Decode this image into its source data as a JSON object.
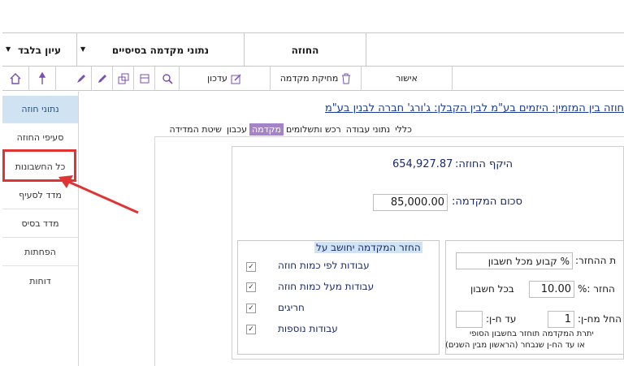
{
  "topbar": {
    "view_only": "עיון בלבד",
    "basic_advance_data": "נתוני מקדמה בסיסיים",
    "contract": "החוזה"
  },
  "toolbar": {
    "update": "עדכון",
    "delete_advance": "מחיקת מקדמה",
    "approve": "אישור"
  },
  "sidebar": {
    "items": [
      {
        "label": "נתוני חוזה"
      },
      {
        "label": "סעיפי החוזה"
      },
      {
        "label": "כל החשבונות"
      },
      {
        "label": "מדד לסעיף"
      },
      {
        "label": "מדד בסיס"
      },
      {
        "label": "הפחתות"
      },
      {
        "label": "דוחות"
      }
    ]
  },
  "main": {
    "title": "חוזה בין המזמין: היזמים בע\"מ  לבין הקבלן: ג'ורג' חברה לבנין בע\"מ",
    "tabs": [
      {
        "label": "כללי"
      },
      {
        "label": "נתוני עבודה"
      },
      {
        "label": "רכש ותשלומים"
      },
      {
        "label": "מקדמה"
      },
      {
        "label": "עכבון"
      },
      {
        "label": "שיטת המדידה"
      }
    ],
    "contract_scope_label": "היקף החוזה:",
    "contract_scope_value": "654,927.87",
    "advance_amount_label": "סכום המקדמה:",
    "advance_amount_value": "85,000.00",
    "recoup_title": "החזר המקדמה יחושב על",
    "recoup_items": [
      {
        "label": "עבודות לפי כמות חוזה",
        "checked": true
      },
      {
        "label": "עבודות מעל כמות חוזה",
        "checked": true
      },
      {
        "label": "חריגים",
        "checked": true
      },
      {
        "label": "עבודות נוספות",
        "checked": true
      }
    ],
    "recoup_method_label": "ת ההחזר:",
    "recoup_method_value": "% קבוע מכל חשבון",
    "recoup_percent_label": "החזר :%",
    "recoup_percent_value": "10.00",
    "recoup_percent_suffix": "בכל חשבון",
    "from_label": "החל מח-ן:",
    "from_value": "1",
    "until_label": "עד ח-ן:",
    "until_value": "",
    "note_line1": "יתרת המקדמה תוחזר בחשבון הסופי",
    "note_line2": "או עד הח-ן שנבחר (הראשון מבין השנים)"
  },
  "colors": {
    "accent": "#a484c6",
    "sidebar_active": "#cfe3f2",
    "callout": "#e03434",
    "title_blue": "#1a3a9a"
  }
}
